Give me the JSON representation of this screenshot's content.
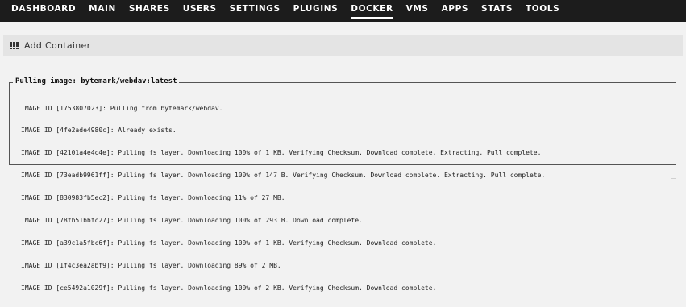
{
  "nav": {
    "items": [
      {
        "label": "DASHBOARD"
      },
      {
        "label": "MAIN"
      },
      {
        "label": "SHARES"
      },
      {
        "label": "USERS"
      },
      {
        "label": "SETTINGS"
      },
      {
        "label": "PLUGINS"
      },
      {
        "label": "DOCKER"
      },
      {
        "label": "VMS"
      },
      {
        "label": "APPS"
      },
      {
        "label": "STATS"
      },
      {
        "label": "TOOLS"
      }
    ],
    "active": "DOCKER"
  },
  "title_bar": {
    "icon": "grid-icon",
    "title": "Add Container"
  },
  "log": {
    "legend": "Pulling image: bytemark/webdav:latest",
    "lines": [
      "IMAGE ID [1753807023]: Pulling from bytemark/webdav.",
      "IMAGE ID [4fe2ade4980c]: Already exists.",
      "IMAGE ID [42101a4e4c4e]: Pulling fs layer. Downloading 100% of 1 KB. Verifying Checksum. Download complete. Extracting. Pull complete.",
      "IMAGE ID [73eadb9961ff]: Pulling fs layer. Downloading 100% of 147 B. Verifying Checksum. Download complete. Extracting. Pull complete.",
      "IMAGE ID [830983fb5ec2]: Pulling fs layer. Downloading 11% of 27 MB.",
      "IMAGE ID [78fb51bbfc27]: Pulling fs layer. Downloading 100% of 293 B. Download complete.",
      "IMAGE ID [a39c1a5fbc6f]: Pulling fs layer. Downloading 100% of 1 KB. Verifying Checksum. Download complete.",
      "IMAGE ID [1f4c3ea2abf9]: Pulling fs layer. Downloading 89% of 2 MB.",
      "IMAGE ID [ce5492a1029f]: Pulling fs layer. Downloading 100% of 2 KB. Verifying Checksum. Download complete."
    ]
  }
}
